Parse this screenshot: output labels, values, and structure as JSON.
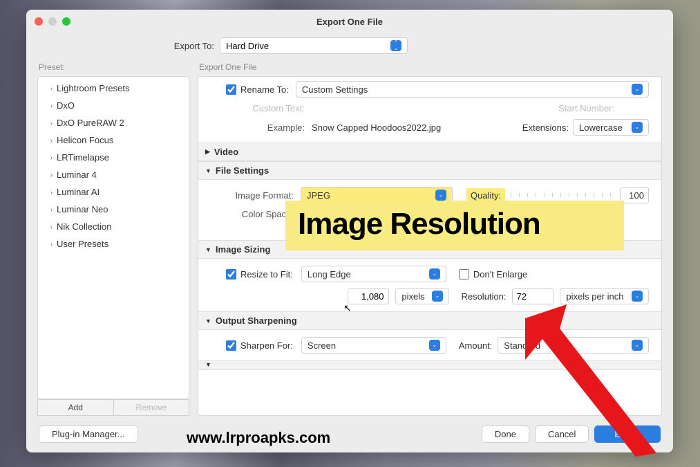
{
  "window": {
    "title": "Export One File"
  },
  "export_to": {
    "label": "Export To:",
    "value": "Hard Drive"
  },
  "sidebar": {
    "label": "Preset:",
    "items": [
      {
        "label": "Lightroom Presets"
      },
      {
        "label": "DxO"
      },
      {
        "label": "DxO PureRAW 2"
      },
      {
        "label": "Helicon Focus"
      },
      {
        "label": "LRTimelapse"
      },
      {
        "label": "Luminar 4"
      },
      {
        "label": "Luminar AI"
      },
      {
        "label": "Luminar Neo"
      },
      {
        "label": "Nik Collection"
      },
      {
        "label": "User Presets"
      }
    ],
    "add": "Add",
    "remove": "Remove"
  },
  "content": {
    "label": "Export One File",
    "rename": {
      "checkbox": "Rename To:",
      "value": "Custom Settings",
      "custom_text": "Custom Text:",
      "start_number": "Start Number:",
      "example_lbl": "Example:",
      "example_val": "Snow Capped Hoodoos2022.jpg",
      "ext_lbl": "Extensions:",
      "ext_val": "Lowercase"
    },
    "video": {
      "title": "Video"
    },
    "file_settings": {
      "title": "File Settings",
      "format_lbl": "Image Format:",
      "format_val": "JPEG",
      "quality_lbl": "Quality:",
      "quality_val": "100",
      "color_lbl": "Color Space:"
    },
    "image_sizing": {
      "title": "Image Sizing",
      "resize_lbl": "Resize to Fit:",
      "resize_val": "Long Edge",
      "dont_enlarge": "Don't Enlarge",
      "size_val": "1,080",
      "size_unit": "pixels",
      "res_lbl": "Resolution:",
      "res_val": "72",
      "res_unit": "pixels per inch"
    },
    "sharpening": {
      "title": "Output Sharpening",
      "sharpen_lbl": "Sharpen For:",
      "sharpen_val": "Screen",
      "amount_lbl": "Amount:",
      "amount_val": "Standard"
    }
  },
  "footer": {
    "plugin": "Plug-in Manager...",
    "done": "Done",
    "cancel": "Cancel",
    "export": "Export"
  },
  "overlay": "Image Resolution",
  "watermark": "www.lrproapks.com"
}
